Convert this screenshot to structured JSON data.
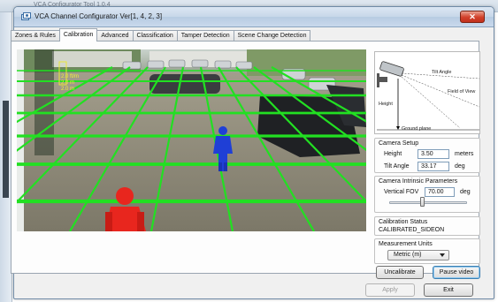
{
  "background_window": {
    "title": "VCA Configurator Tool 1.0.4"
  },
  "window": {
    "title": "VCA Channel Configurator Ver[1, 4, 2, 3]",
    "close_glyph": "✕"
  },
  "tabs": [
    {
      "label": "Zones & Rules",
      "active": false
    },
    {
      "label": "Calibration",
      "active": true
    },
    {
      "label": "Advanced",
      "active": false
    },
    {
      "label": "Classification",
      "active": false
    },
    {
      "label": "Tamper Detection",
      "active": false
    },
    {
      "label": "Scene Change Detection",
      "active": false
    }
  ],
  "video": {
    "ruler_labels": [
      "2.0 ft/m",
      "2.0 m",
      "2.0 m"
    ],
    "grid_color": "#22e022",
    "marker_colors": {
      "near": "#e8261e",
      "far": "#1f3fd6"
    }
  },
  "diagram": {
    "labels": {
      "angle": "Tilt Angle",
      "fov": "Field of View",
      "height": "Height",
      "ground": "Ground plane"
    }
  },
  "camera_setup": {
    "title": "Camera Setup",
    "height_label": "Height",
    "height_value": "3.50",
    "height_unit": "meters",
    "tilt_label": "Tilt Angle",
    "tilt_value": "33.17",
    "tilt_unit": "deg"
  },
  "intrinsics": {
    "title": "Camera Intrinsic Parameters",
    "fov_label": "Vertical FOV",
    "fov_value": "70.00",
    "fov_unit": "deg",
    "slider_position": 0.42
  },
  "calibration_status": {
    "title": "Calibration Status",
    "value": "CALIBRATED_SIDEON"
  },
  "measurement_units": {
    "title": "Measurement Units",
    "selected": "Metric (m)"
  },
  "buttons": {
    "uncalibrate": "Uncalibrate",
    "pause_video": "Pause video",
    "apply": "Apply",
    "exit": "Exit"
  }
}
